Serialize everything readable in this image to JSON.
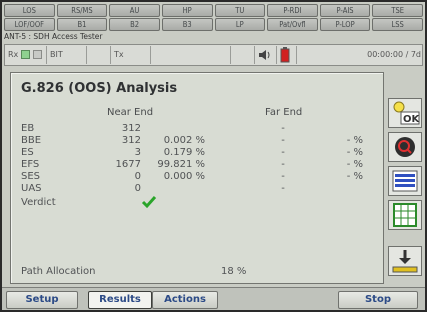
{
  "alarms_row1": [
    "LOS",
    "RS/MS",
    "AU",
    "HP",
    "TU",
    "P-RDI",
    "P-AIS",
    "TSE"
  ],
  "alarms_row2": [
    "LOF/OOF",
    "B1",
    "B2",
    "B3",
    "LP",
    "Pat/Ovfl",
    "P-LOP",
    "LSS"
  ],
  "device_title": "ANT-5 : SDH Access Tester",
  "status": {
    "rx_label": "Rx",
    "bit_label": "BIT",
    "tx_label": "Tx",
    "time": "00:00:00 / 7d"
  },
  "panel": {
    "title": "G.826 (OOS) Analysis",
    "near_header": "Near End",
    "far_header": "Far End",
    "rows": [
      {
        "label": "EB",
        "near": "312",
        "near_pct": "",
        "far": "-",
        "far_pct": ""
      },
      {
        "label": "BBE",
        "near": "312",
        "near_pct": "0.002 %",
        "far": "-",
        "far_pct": "- %"
      },
      {
        "label": "ES",
        "near": "3",
        "near_pct": "0.179 %",
        "far": "-",
        "far_pct": "- %"
      },
      {
        "label": "EFS",
        "near": "1677",
        "near_pct": "99.821 %",
        "far": "-",
        "far_pct": "- %"
      },
      {
        "label": "SES",
        "near": "0",
        "near_pct": "0.000 %",
        "far": "-",
        "far_pct": "- %"
      },
      {
        "label": "UAS",
        "near": "0",
        "near_pct": "",
        "far": "-",
        "far_pct": ""
      }
    ],
    "verdict_label": "Verdict",
    "path_allocation_label": "Path Allocation",
    "path_allocation_value": "18 %"
  },
  "side_icons": [
    "ok-icon",
    "zoom-icon",
    "list-icon",
    "grid-icon",
    "download-icon"
  ],
  "side_ok_text": "OK",
  "bottom": {
    "setup": "Setup",
    "results": "Results",
    "actions": "Actions",
    "stop": "Stop"
  },
  "colors": {
    "verdict_check": "#2aa52a",
    "button_text": "#2c4b87",
    "stop_led": "#d02020"
  }
}
